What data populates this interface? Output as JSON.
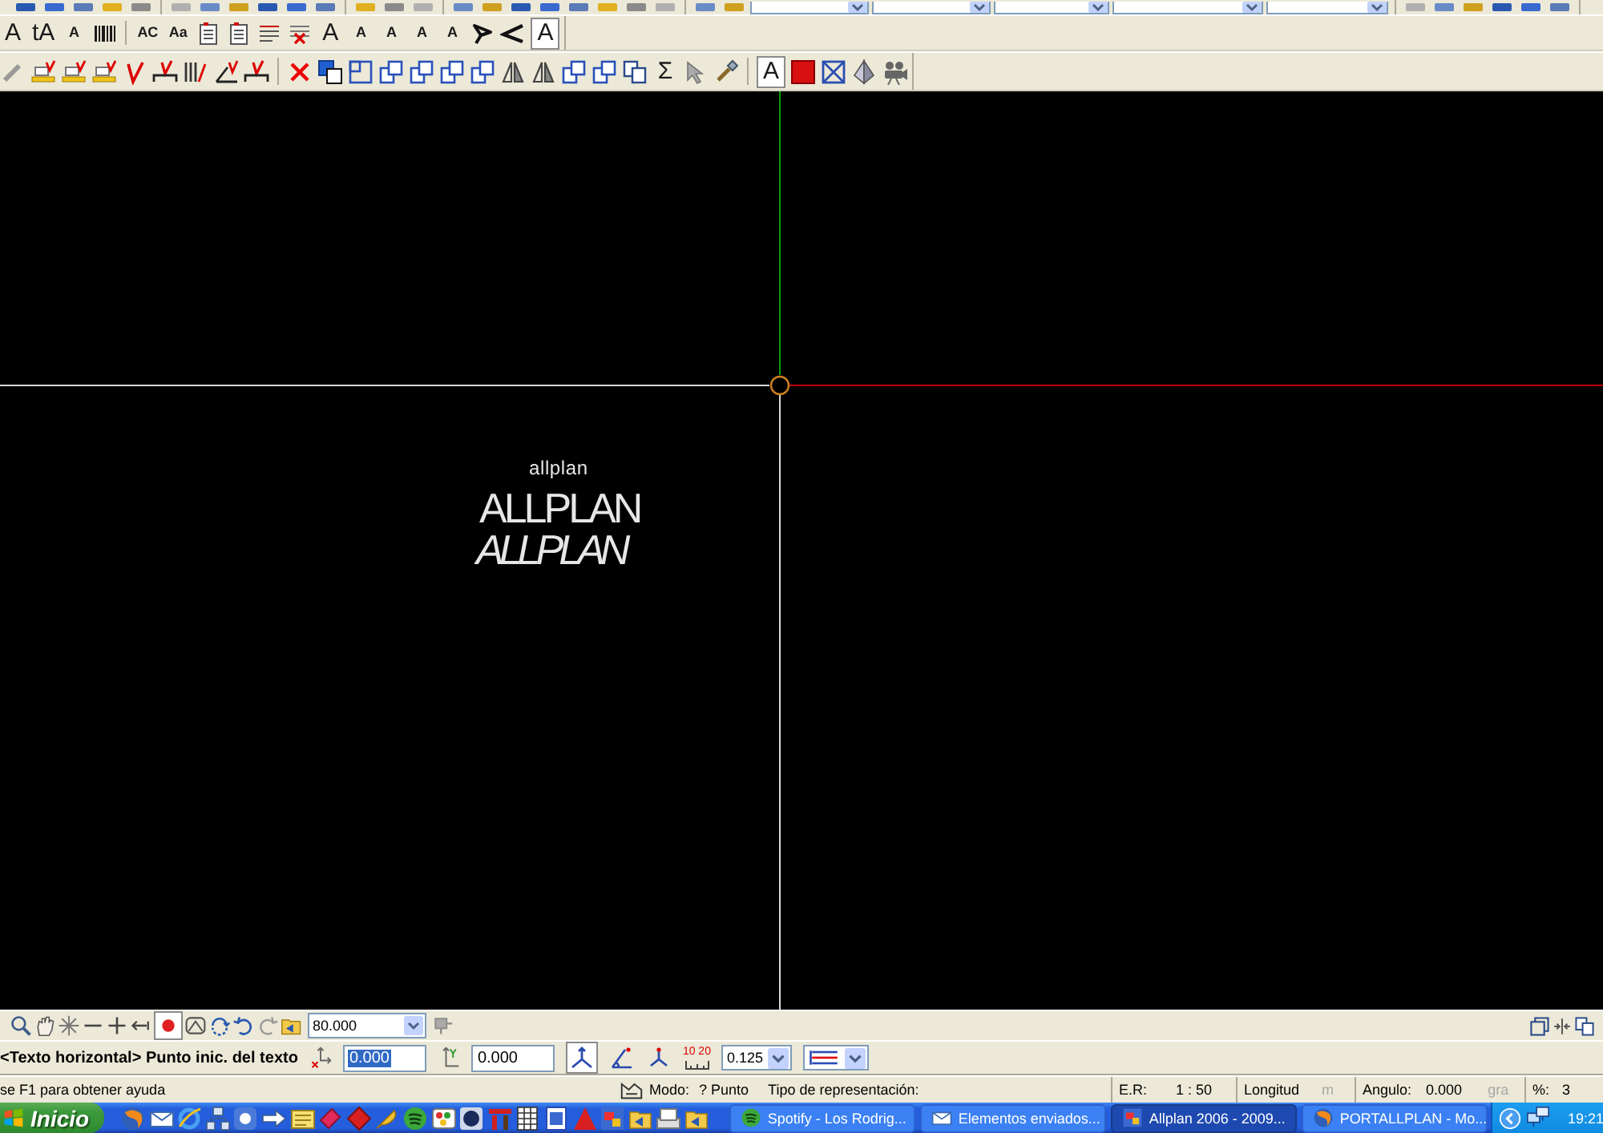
{
  "top_toolbar": {
    "groups": [
      {
        "items": [
          {
            "kind": "icon"
          },
          {
            "kind": "icon"
          },
          {
            "kind": "icon"
          },
          {
            "kind": "icon"
          },
          {
            "kind": "icon"
          }
        ]
      },
      {
        "items": [
          {
            "kind": "icon"
          },
          {
            "kind": "icon"
          },
          {
            "kind": "icon"
          },
          {
            "kind": "icon"
          },
          {
            "kind": "icon"
          },
          {
            "kind": "icon"
          }
        ]
      },
      {
        "items": [
          {
            "kind": "icon"
          },
          {
            "kind": "icon"
          },
          {
            "kind": "icon"
          }
        ]
      },
      {
        "items": [
          {
            "kind": "icon"
          },
          {
            "kind": "icon"
          },
          {
            "kind": "icon"
          },
          {
            "kind": "icon"
          },
          {
            "kind": "icon"
          },
          {
            "kind": "icon"
          },
          {
            "kind": "icon"
          },
          {
            "kind": "icon"
          }
        ]
      },
      {
        "items": [
          {
            "kind": "icon"
          },
          {
            "kind": "icon"
          },
          {
            "kind": "dropdown"
          },
          {
            "kind": "dropdown"
          },
          {
            "kind": "dropdown"
          },
          {
            "kind": "dropdown"
          },
          {
            "kind": "dropdown"
          }
        ]
      },
      {
        "items": [
          {
            "kind": "icon"
          },
          {
            "kind": "icon"
          },
          {
            "kind": "icon"
          },
          {
            "kind": "icon"
          },
          {
            "kind": "icon"
          },
          {
            "kind": "icon"
          }
        ]
      }
    ]
  },
  "text_toolbar": {
    "groups": [
      {
        "items": [
          {
            "kind": "letter",
            "label": "A",
            "selected": false
          },
          {
            "kind": "letter",
            "label": "tA",
            "selected": false
          },
          {
            "kind": "small-letter",
            "label": "A",
            "selected": false
          },
          {
            "kind": "barcode",
            "selected": false
          }
        ]
      },
      {
        "items": [
          {
            "kind": "small-letter",
            "label": "AC",
            "selected": false
          },
          {
            "kind": "small-letter",
            "label": "Aa",
            "selected": false
          },
          {
            "kind": "text-block",
            "selected": false
          },
          {
            "kind": "text-block",
            "selected": false
          },
          {
            "kind": "lines",
            "selected": false
          },
          {
            "kind": "lines-cross",
            "selected": false
          },
          {
            "kind": "letter",
            "label": "A",
            "selected": false
          },
          {
            "kind": "small-letter",
            "label": "A",
            "selected": false
          },
          {
            "kind": "small-letter",
            "label": "A",
            "selected": false
          },
          {
            "kind": "small-letter",
            "label": "A",
            "selected": false
          },
          {
            "kind": "small-letter",
            "label": "A",
            "selected": false
          },
          {
            "kind": "angle-arrow",
            "selected": false
          },
          {
            "kind": "angle",
            "selected": false
          },
          {
            "kind": "letter",
            "label": "A",
            "selected": true
          }
        ]
      }
    ]
  },
  "edit_toolbar": {
    "groups": [
      {
        "items": [
          {
            "kind": "pencil",
            "selected": false
          },
          {
            "kind": "highlight",
            "selected": false
          },
          {
            "kind": "highlight",
            "selected": false
          },
          {
            "kind": "highlight",
            "selected": false
          },
          {
            "kind": "mark",
            "selected": false
          },
          {
            "kind": "mark-line",
            "selected": false
          },
          {
            "kind": "hatch",
            "selected": false
          },
          {
            "kind": "angle-edit",
            "selected": false
          },
          {
            "kind": "mark-line",
            "selected": false
          }
        ]
      },
      {
        "items": [
          {
            "kind": "delete",
            "selected": false
          },
          {
            "kind": "copy-squares",
            "selected": false
          },
          {
            "kind": "square",
            "selected": false
          },
          {
            "kind": "squares",
            "selected": false
          },
          {
            "kind": "squares",
            "selected": false
          },
          {
            "kind": "squares",
            "selected": false
          },
          {
            "kind": "squares",
            "selected": false
          },
          {
            "kind": "mirror",
            "selected": false
          },
          {
            "kind": "mirror",
            "selected": false
          },
          {
            "kind": "squares",
            "selected": false
          },
          {
            "kind": "squares",
            "selected": false
          },
          {
            "kind": "copy",
            "selected": false
          },
          {
            "kind": "symbol",
            "label": "Σ",
            "selected": false
          },
          {
            "kind": "pointer",
            "selected": false
          },
          {
            "kind": "brush",
            "selected": false
          }
        ]
      },
      {
        "items": [
          {
            "kind": "letter",
            "label": "A",
            "selected": true
          },
          {
            "kind": "swatch",
            "selected": false
          },
          {
            "kind": "frame-x",
            "selected": false
          },
          {
            "kind": "pyramid",
            "selected": false
          },
          {
            "kind": "camera",
            "selected": false
          }
        ]
      }
    ]
  },
  "canvas": {
    "texts": [
      {
        "kind": "small",
        "text": "allplan"
      },
      {
        "kind": "large",
        "text": "ALLPLAN"
      },
      {
        "kind": "slanted",
        "text": "ALLPLAN"
      }
    ]
  },
  "view_toolbar": {
    "items": [
      {
        "kind": "zoom",
        "selected": false
      },
      {
        "kind": "hand",
        "selected": false
      },
      {
        "kind": "sparkle",
        "selected": false
      },
      {
        "kind": "minus",
        "selected": false
      },
      {
        "kind": "plus",
        "selected": false
      },
      {
        "kind": "arrow-left",
        "selected": false
      },
      {
        "kind": "dot",
        "selected": true
      },
      {
        "kind": "landscape",
        "selected": false
      },
      {
        "kind": "rotate",
        "selected": false
      },
      {
        "kind": "undo",
        "selected": false
      },
      {
        "kind": "redo",
        "selected": false
      },
      {
        "kind": "folder",
        "selected": false
      }
    ],
    "zoom_value": "80.000",
    "tail_items": [
      {
        "kind": "pin",
        "selected": false
      }
    ],
    "right_items": [
      {
        "kind": "window",
        "selected": false
      },
      {
        "kind": "split",
        "selected": false
      },
      {
        "kind": "copy",
        "selected": false
      }
    ]
  },
  "command_line": {
    "prompt": "<Texto horizontal> Punto inic. del texto",
    "fields": [
      {
        "value": "0.000",
        "highlighted": true
      },
      {
        "value": "0.000",
        "highlighted": false
      }
    ],
    "tools": [
      {
        "kind": "axes",
        "selected": true
      },
      {
        "kind": "angle-point",
        "selected": false
      },
      {
        "kind": "axes-small",
        "selected": false
      }
    ],
    "ruler_label": "10 20",
    "spacing_value": "0.125"
  },
  "status_bar": {
    "help": "se F1 para obtener ayuda",
    "mode_label": "Modo:",
    "mode_value": "? Punto",
    "representation_label": "Tipo de representación:",
    "scale_label": "E.R:",
    "scale_value": "1 : 50",
    "length_label": "Longitud",
    "length_unit": "m",
    "angle_label": "Angulo:",
    "angle_value": "0.000",
    "angle_unit": "gra",
    "percent_label": "%:",
    "percent_value": "3"
  },
  "taskbar": {
    "start_label": "Inicio",
    "quick_launch": [
      {
        "kind": "globe"
      },
      {
        "kind": "envelope"
      },
      {
        "kind": "ring"
      },
      {
        "kind": "network"
      },
      {
        "kind": "app"
      },
      {
        "kind": "arrow"
      },
      {
        "kind": "note"
      },
      {
        "kind": "tag"
      },
      {
        "kind": "diamond"
      },
      {
        "kind": "feather"
      },
      {
        "kind": "disc"
      },
      {
        "kind": "palette"
      },
      {
        "kind": "sphere"
      },
      {
        "kind": "bars"
      },
      {
        "kind": "grid"
      },
      {
        "kind": "document"
      },
      {
        "kind": "triangle"
      },
      {
        "kind": "tiles"
      },
      {
        "kind": "folder"
      },
      {
        "kind": "printer"
      },
      {
        "kind": "folder"
      }
    ],
    "tasks": [
      {
        "label": "Spotify - Los Rodrig...",
        "kind": "disc",
        "selected": false
      },
      {
        "label": "Elementos enviados...",
        "kind": "envelope",
        "selected": false
      },
      {
        "label": "Allplan 2006 - 2009...",
        "kind": "tiles",
        "selected": true
      },
      {
        "label": "PORTALLPLAN - Mo...",
        "kind": "globe",
        "selected": false
      }
    ],
    "clock": "19:21"
  }
}
